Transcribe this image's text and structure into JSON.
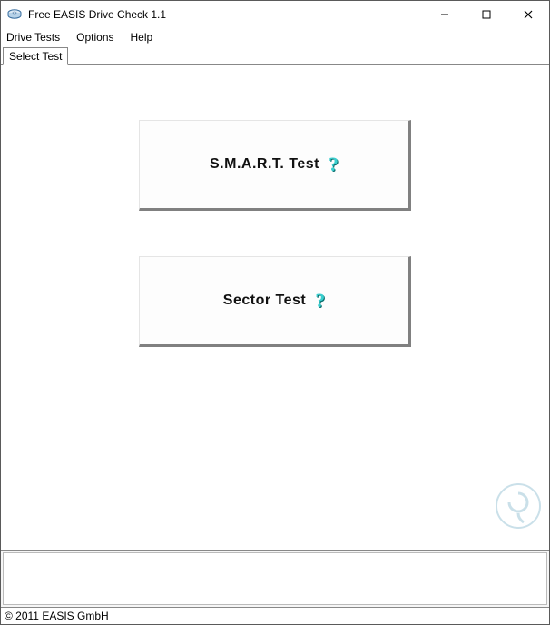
{
  "title": "Free EASIS Drive Check 1.1",
  "menu": {
    "drive_tests": "Drive Tests",
    "options": "Options",
    "help": "Help"
  },
  "tabs": {
    "select_test": "Select Test"
  },
  "buttons": {
    "smart_label": "S.M.A.R.T. Test",
    "sector_label": "Sector Test",
    "help_glyph": "?"
  },
  "status": {
    "copyright": "© 2011 EASIS GmbH"
  },
  "icons": {
    "app": "disk-icon",
    "minimize": "minimize-icon",
    "maximize": "maximize-icon",
    "close": "close-icon",
    "help": "help-icon"
  },
  "colors": {
    "help_glyph": "#39cfcf",
    "button_shadow": "#808080"
  }
}
